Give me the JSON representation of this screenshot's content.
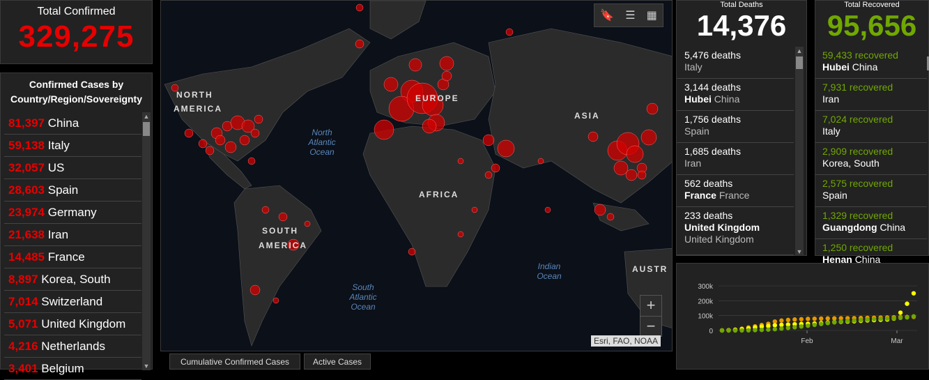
{
  "confirmed": {
    "label": "Total Confirmed",
    "value": "329,275"
  },
  "countries": {
    "header": "Confirmed Cases by Country/Region/Sovereignty",
    "items": [
      {
        "value": "81,397",
        "name": "China"
      },
      {
        "value": "59,138",
        "name": "Italy"
      },
      {
        "value": "32,057",
        "name": "US"
      },
      {
        "value": "28,603",
        "name": "Spain"
      },
      {
        "value": "23,974",
        "name": "Germany"
      },
      {
        "value": "21,638",
        "name": "Iran"
      },
      {
        "value": "14,485",
        "name": "France"
      },
      {
        "value": "8,897",
        "name": "Korea, South"
      },
      {
        "value": "7,014",
        "name": "Switzerland"
      },
      {
        "value": "5,071",
        "name": "United Kingdom"
      },
      {
        "value": "4,216",
        "name": "Netherlands"
      },
      {
        "value": "3,401",
        "name": "Belgium"
      }
    ]
  },
  "map": {
    "labels": {
      "north_america_1": "NORTH",
      "north_america_2": "AMERICA",
      "south_america_1": "SOUTH",
      "south_america_2": "AMERICA",
      "europe": "EUROPE",
      "africa": "AFRICA",
      "asia": "ASIA",
      "australia": "AUSTR"
    },
    "oceans": {
      "north_atlantic": "North Atlantic Ocean",
      "south_atlantic": "South Atlantic Ocean",
      "indian": "Indian Ocean"
    },
    "attribution": "Esri, FAO, NOAA",
    "zoom_in": "+",
    "zoom_out": "−"
  },
  "tabs": [
    {
      "label": "Cumulative Confirmed Cases"
    },
    {
      "label": "Active Cases"
    }
  ],
  "deaths": {
    "label": "Total Deaths",
    "value": "14,376",
    "items": [
      {
        "count": "5,476 deaths",
        "region": "",
        "place": "Italy"
      },
      {
        "count": "3,144 deaths",
        "region": "Hubei",
        "place": "China"
      },
      {
        "count": "1,756 deaths",
        "region": "",
        "place": "Spain"
      },
      {
        "count": "1,685 deaths",
        "region": "",
        "place": "Iran"
      },
      {
        "count": "562 deaths",
        "region": "France",
        "place": "France"
      },
      {
        "count": "233 deaths",
        "region": "United Kingdom",
        "place": "United Kingdom"
      }
    ]
  },
  "recovered": {
    "label": "Total Recovered",
    "value": "95,656",
    "items": [
      {
        "count": "59,433 recovered",
        "region": "Hubei",
        "place": "China"
      },
      {
        "count": "7,931 recovered",
        "region": "",
        "place": "Iran"
      },
      {
        "count": "7,024 recovered",
        "region": "",
        "place": "Italy"
      },
      {
        "count": "2,909 recovered",
        "region": "",
        "place": "Korea, South"
      },
      {
        "count": "2,575 recovered",
        "region": "",
        "place": "Spain"
      },
      {
        "count": "1,329 recovered",
        "region": "Guangdong",
        "place": "China"
      },
      {
        "count": "1,250 recovered",
        "region": "Henan",
        "place": "China"
      }
    ]
  },
  "chart_data": {
    "type": "line",
    "yticks": [
      "0",
      "100k",
      "200k",
      "300k"
    ],
    "xticks": [
      "Feb",
      "Mar"
    ],
    "ylim": [
      0,
      300000
    ],
    "series": [
      {
        "color": "#e69800",
        "values": [
          600,
          2000,
          6000,
          12000,
          20000,
          28000,
          37000,
          45000,
          60000,
          67000,
          71000,
          74000,
          76000,
          78000,
          79000,
          80000,
          81000,
          81500,
          82000,
          82500,
          83000,
          84000,
          85000,
          86000,
          87000,
          88000,
          89000,
          90000,
          91000,
          92000
        ]
      },
      {
        "color": "#ffff00",
        "values": [
          500,
          1500,
          4000,
          8000,
          14000,
          20000,
          26000,
          30000,
          35000,
          38000,
          40000,
          42000,
          44000,
          45000,
          47000,
          50000,
          53000,
          56000,
          58000,
          60000,
          62000,
          65000,
          68000,
          70000,
          72000,
          74000,
          80000,
          120000,
          180000,
          250000
        ]
      },
      {
        "color": "#70a800",
        "values": [
          0,
          50,
          200,
          500,
          1200,
          2500,
          4000,
          6000,
          9000,
          13000,
          17000,
          22000,
          27000,
          32000,
          38000,
          44000,
          50000,
          55000,
          60000,
          64000,
          67000,
          70000,
          73000,
          76000,
          78000,
          80000,
          82000,
          85000,
          88000,
          95000
        ]
      }
    ]
  }
}
